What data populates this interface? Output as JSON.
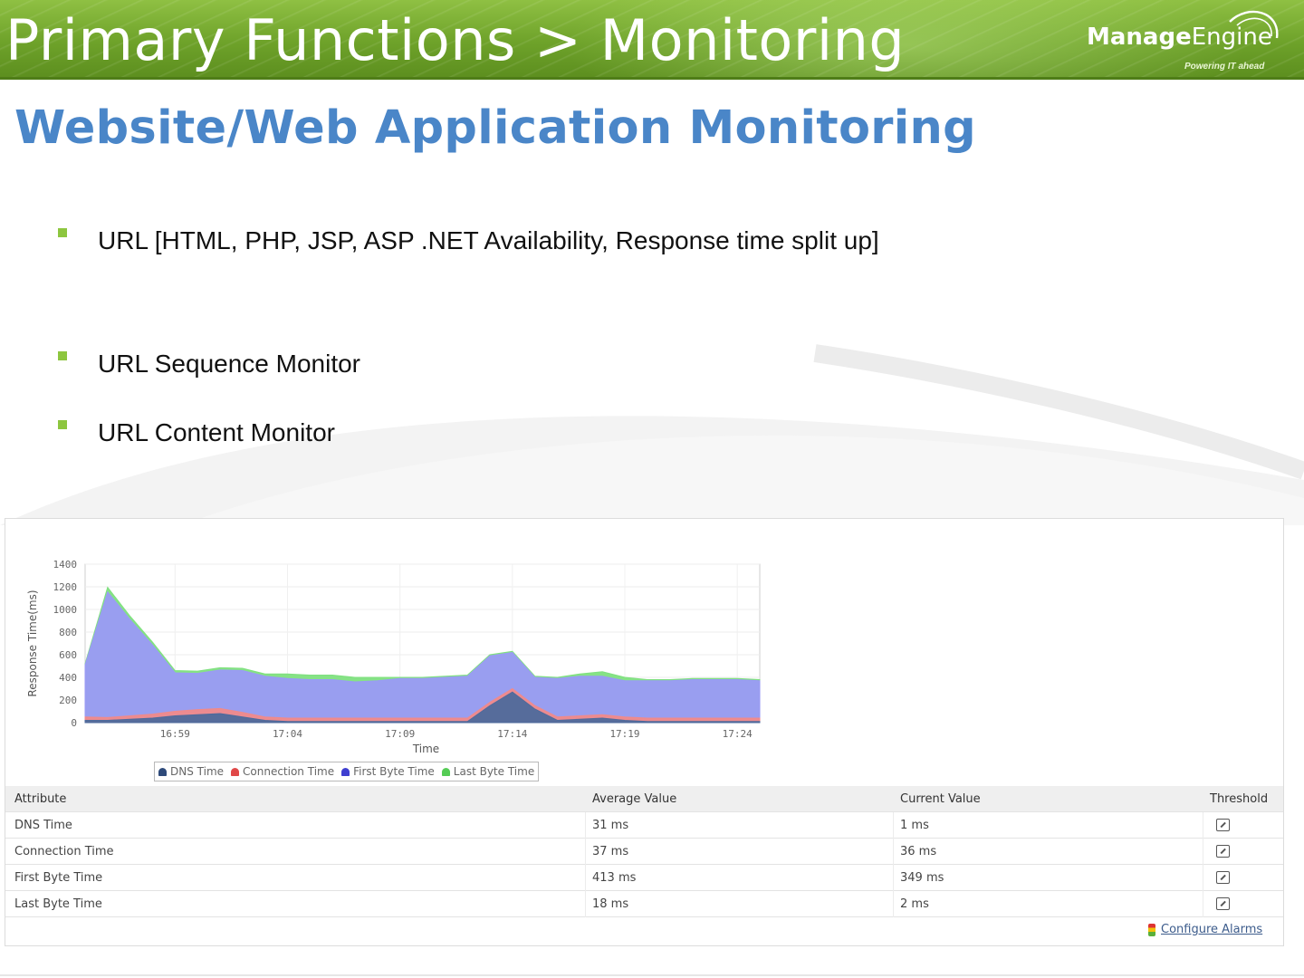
{
  "header": {
    "title": "Primary Functions > Monitoring",
    "brand": {
      "name_bold": "Manage",
      "name_light": "Engine",
      "tagline": "Powering IT ahead"
    }
  },
  "page": {
    "title": "Website/Web Application Monitoring",
    "bullets": [
      "URL [HTML, PHP, JSP, ASP .NET Availability, Response time split up]",
      "URL Sequence Monitor",
      "URL Content Monitor"
    ]
  },
  "colors": {
    "header_green": "#6ea22a",
    "title_blue": "#4a86c8",
    "bullet_green": "#8dc63f"
  },
  "chart_data": {
    "type": "area",
    "title": "",
    "xlabel": "Time",
    "ylabel": "Response Time(ms)",
    "ylim": [
      0,
      1400
    ],
    "yticks": [
      0,
      200,
      400,
      600,
      800,
      1000,
      1200,
      1400
    ],
    "x_tick_labels": [
      "16:59",
      "17:04",
      "17:09",
      "17:14",
      "17:19",
      "17:24"
    ],
    "x": [
      "16:55",
      "16:56",
      "16:57",
      "16:58",
      "16:59",
      "17:00",
      "17:01",
      "17:02",
      "17:03",
      "17:04",
      "17:05",
      "17:06",
      "17:07",
      "17:08",
      "17:09",
      "17:10",
      "17:11",
      "17:12",
      "17:13",
      "17:14",
      "17:15",
      "17:16",
      "17:17",
      "17:18",
      "17:19",
      "17:20",
      "17:21",
      "17:22",
      "17:23",
      "17:24",
      "17:25"
    ],
    "stacked": true,
    "legend_position": "bottom",
    "series": [
      {
        "name": "DNS Time",
        "color": "#4e6a9c",
        "values": [
          20,
          20,
          30,
          40,
          60,
          70,
          80,
          50,
          20,
          10,
          10,
          10,
          10,
          10,
          10,
          10,
          10,
          10,
          150,
          270,
          120,
          20,
          30,
          40,
          20,
          10,
          10,
          10,
          10,
          10,
          10
        ]
      },
      {
        "name": "Connection Time",
        "color": "#f08a8a",
        "values": [
          30,
          25,
          30,
          35,
          40,
          45,
          45,
          40,
          30,
          30,
          30,
          30,
          30,
          30,
          30,
          30,
          30,
          30,
          30,
          30,
          30,
          30,
          30,
          30,
          30,
          30,
          30,
          30,
          30,
          30,
          30
        ]
      },
      {
        "name": "First Byte Time",
        "color": "#9a9af5",
        "values": [
          460,
          1110,
          850,
          610,
          340,
          320,
          340,
          370,
          360,
          350,
          340,
          340,
          320,
          330,
          350,
          350,
          360,
          370,
          410,
          320,
          250,
          340,
          350,
          340,
          320,
          330,
          330,
          340,
          340,
          340,
          330
        ]
      },
      {
        "name": "Last Byte Time",
        "color": "#7fe07f",
        "values": [
          10,
          40,
          30,
          25,
          20,
          20,
          20,
          20,
          20,
          40,
          40,
          40,
          40,
          30,
          10,
          10,
          10,
          10,
          10,
          10,
          10,
          10,
          20,
          40,
          30,
          10,
          10,
          10,
          10,
          10,
          10
        ]
      }
    ]
  },
  "table": {
    "headers": [
      "Attribute",
      "Average Value",
      "Current Value",
      "Threshold"
    ],
    "rows": [
      {
        "attribute": "DNS Time",
        "average": "31 ms",
        "current": "1 ms"
      },
      {
        "attribute": "Connection Time",
        "average": "37 ms",
        "current": "36 ms"
      },
      {
        "attribute": "First Byte Time",
        "average": "413 ms",
        "current": "349 ms"
      },
      {
        "attribute": "Last Byte Time",
        "average": "18 ms",
        "current": "2 ms"
      }
    ],
    "configure_alarms": "Configure Alarms"
  }
}
